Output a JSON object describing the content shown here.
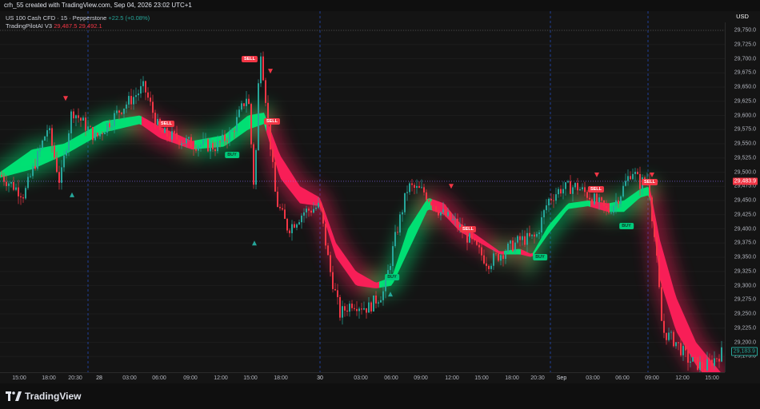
{
  "header": {
    "title": "crh_55 created with TradingView.com, Sep 04, 2026 23:02 UTC+1"
  },
  "legend": {
    "symbol": "US 100 Cash CFD · 15 · Pepperstone",
    "change": "+22.5 (+0.08%)",
    "indicator": "TradingPilotAI V3",
    "indicator_value_1": "29,487.5",
    "indicator_value_2": "29,492.1"
  },
  "price_axis": {
    "currency": "USD",
    "labels": [
      "29,750.0",
      "29,725.0",
      "29,700.0",
      "29,675.0",
      "29,650.0",
      "29,625.0",
      "29,600.0",
      "29,575.0",
      "29,550.0",
      "29,525.0",
      "29,500.0",
      "29,475.0",
      "29,450.0",
      "29,425.0",
      "29,400.0",
      "29,375.0",
      "29,350.0",
      "29,325.0",
      "29,300.0",
      "29,275.0",
      "29,250.0",
      "29,225.0",
      "29,200.0",
      "29,175.0"
    ],
    "current_price": "29,483.9",
    "last_price": "29,183.9",
    "colors": {
      "current": "#f23645",
      "last": "#26a69a"
    }
  },
  "time_axis": {
    "labels": [
      "15:00",
      "18:00",
      "20:30",
      "28",
      "03:00",
      "06:00",
      "09:00",
      "12:00",
      "15:00",
      "18:00",
      "30",
      "03:00",
      "06:00",
      "09:00",
      "12:00",
      "15:00",
      "18:00",
      "20:30",
      "Sep",
      "03:00",
      "06:00",
      "09:00",
      "12:00",
      "15:00"
    ]
  },
  "signals": {
    "sell_label": "SELL",
    "buy_label": "BUY"
  },
  "footer": {
    "brand": "TradingView"
  },
  "chart_data": {
    "type": "candlestick",
    "symbol": "US 100 Cash CFD",
    "interval": "15",
    "ylim": [
      29160,
      29770
    ],
    "colors": {
      "up": "#26a69a",
      "down": "#f23645",
      "bull_band": "#00e676",
      "bear_band": "#ff1f5a"
    },
    "price_path": [
      [
        0,
        29495
      ],
      [
        30,
        29460
      ],
      [
        60,
        29580
      ],
      [
        75,
        29480
      ],
      [
        90,
        29610
      ],
      [
        120,
        29560
      ],
      [
        150,
        29610
      ],
      [
        180,
        29650
      ],
      [
        200,
        29570
      ],
      [
        240,
        29550
      ],
      [
        270,
        29545
      ],
      [
        290,
        29570
      ],
      [
        310,
        29640
      ],
      [
        318,
        29460
      ],
      [
        325,
        29730
      ],
      [
        335,
        29590
      ],
      [
        345,
        29450
      ],
      [
        360,
        29400
      ],
      [
        380,
        29430
      ],
      [
        400,
        29440
      ],
      [
        412,
        29330
      ],
      [
        425,
        29250
      ],
      [
        440,
        29270
      ],
      [
        460,
        29260
      ],
      [
        480,
        29290
      ],
      [
        495,
        29390
      ],
      [
        510,
        29475
      ],
      [
        530,
        29465
      ],
      [
        550,
        29430
      ],
      [
        570,
        29410
      ],
      [
        590,
        29375
      ],
      [
        610,
        29340
      ],
      [
        630,
        29360
      ],
      [
        650,
        29380
      ],
      [
        670,
        29385
      ],
      [
        685,
        29450
      ],
      [
        700,
        29470
      ],
      [
        720,
        29475
      ],
      [
        740,
        29455
      ],
      [
        760,
        29430
      ],
      [
        775,
        29460
      ],
      [
        790,
        29505
      ],
      [
        800,
        29480
      ],
      [
        810,
        29490
      ],
      [
        820,
        29360
      ],
      [
        828,
        29220
      ],
      [
        845,
        29200
      ],
      [
        860,
        29170
      ],
      [
        880,
        29155
      ],
      [
        905,
        29185
      ]
    ],
    "band": [
      [
        0,
        29500,
        29490
      ],
      [
        40,
        29540,
        29505
      ],
      [
        80,
        29550,
        29530
      ],
      [
        130,
        29590,
        29570
      ],
      [
        175,
        29600,
        29585
      ],
      [
        200,
        29580,
        29560
      ],
      [
        240,
        29555,
        29540
      ],
      [
        280,
        29565,
        29545
      ],
      [
        310,
        29600,
        29575
      ],
      [
        330,
        29605,
        29585
      ],
      [
        350,
        29530,
        29490
      ],
      [
        375,
        29475,
        29445
      ],
      [
        400,
        29455,
        29440
      ],
      [
        420,
        29375,
        29350
      ],
      [
        445,
        29325,
        29300
      ],
      [
        470,
        29305,
        29295
      ],
      [
        490,
        29315,
        29300
      ],
      [
        510,
        29400,
        29360
      ],
      [
        535,
        29455,
        29435
      ],
      [
        555,
        29445,
        29425
      ],
      [
        575,
        29410,
        29395
      ],
      [
        600,
        29385,
        29375
      ],
      [
        625,
        29360,
        29355
      ],
      [
        650,
        29365,
        29355
      ],
      [
        665,
        29355,
        29350
      ],
      [
        685,
        29405,
        29390
      ],
      [
        710,
        29445,
        29435
      ],
      [
        735,
        29450,
        29440
      ],
      [
        760,
        29445,
        29430
      ],
      [
        780,
        29450,
        29430
      ],
      [
        800,
        29470,
        29455
      ],
      [
        812,
        29475,
        29460
      ],
      [
        825,
        29380,
        29310
      ],
      [
        845,
        29280,
        29220
      ],
      [
        870,
        29200,
        29160
      ],
      [
        905,
        29140,
        29100
      ]
    ],
    "sell_signals": [
      [
        312,
        29700
      ],
      [
        340,
        29590
      ],
      [
        208,
        29585
      ],
      [
        745,
        29470
      ],
      [
        585,
        29400
      ],
      [
        812,
        29482
      ]
    ],
    "buy_signals": [
      [
        290,
        29530
      ],
      [
        490,
        29315
      ],
      [
        675,
        29350
      ],
      [
        783,
        29405
      ]
    ],
    "triangles_up": [
      [
        90,
        29460
      ],
      [
        318,
        29375
      ],
      [
        488,
        29285
      ]
    ],
    "triangles_down": [
      [
        82,
        29630
      ],
      [
        338,
        29678
      ],
      [
        564,
        29475
      ],
      [
        746,
        29495
      ],
      [
        815,
        29495
      ]
    ],
    "session_lines_x": [
      110,
      400,
      688,
      810
    ],
    "current_price_line": 29483.9,
    "high_line": 29750
  }
}
